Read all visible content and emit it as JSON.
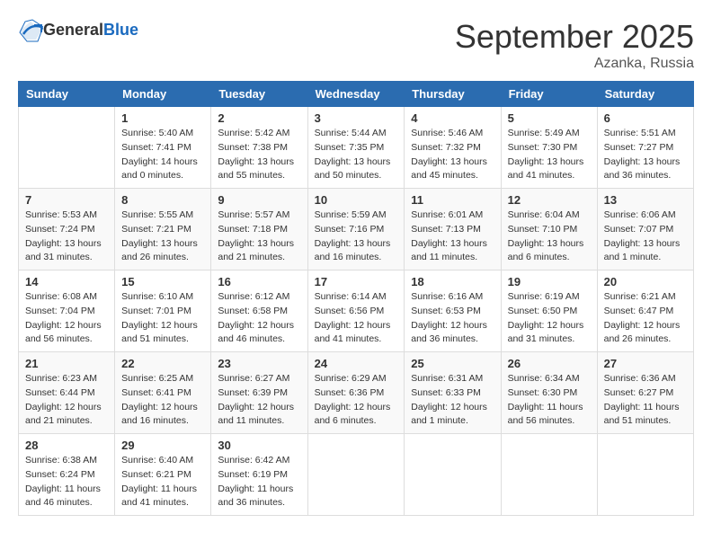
{
  "header": {
    "logo_general": "General",
    "logo_blue": "Blue",
    "month": "September 2025",
    "location": "Azanka, Russia"
  },
  "weekdays": [
    "Sunday",
    "Monday",
    "Tuesday",
    "Wednesday",
    "Thursday",
    "Friday",
    "Saturday"
  ],
  "weeks": [
    [
      {
        "day": "",
        "sunrise": "",
        "sunset": "",
        "daylight": ""
      },
      {
        "day": "1",
        "sunrise": "Sunrise: 5:40 AM",
        "sunset": "Sunset: 7:41 PM",
        "daylight": "Daylight: 14 hours and 0 minutes."
      },
      {
        "day": "2",
        "sunrise": "Sunrise: 5:42 AM",
        "sunset": "Sunset: 7:38 PM",
        "daylight": "Daylight: 13 hours and 55 minutes."
      },
      {
        "day": "3",
        "sunrise": "Sunrise: 5:44 AM",
        "sunset": "Sunset: 7:35 PM",
        "daylight": "Daylight: 13 hours and 50 minutes."
      },
      {
        "day": "4",
        "sunrise": "Sunrise: 5:46 AM",
        "sunset": "Sunset: 7:32 PM",
        "daylight": "Daylight: 13 hours and 45 minutes."
      },
      {
        "day": "5",
        "sunrise": "Sunrise: 5:49 AM",
        "sunset": "Sunset: 7:30 PM",
        "daylight": "Daylight: 13 hours and 41 minutes."
      },
      {
        "day": "6",
        "sunrise": "Sunrise: 5:51 AM",
        "sunset": "Sunset: 7:27 PM",
        "daylight": "Daylight: 13 hours and 36 minutes."
      }
    ],
    [
      {
        "day": "7",
        "sunrise": "Sunrise: 5:53 AM",
        "sunset": "Sunset: 7:24 PM",
        "daylight": "Daylight: 13 hours and 31 minutes."
      },
      {
        "day": "8",
        "sunrise": "Sunrise: 5:55 AM",
        "sunset": "Sunset: 7:21 PM",
        "daylight": "Daylight: 13 hours and 26 minutes."
      },
      {
        "day": "9",
        "sunrise": "Sunrise: 5:57 AM",
        "sunset": "Sunset: 7:18 PM",
        "daylight": "Daylight: 13 hours and 21 minutes."
      },
      {
        "day": "10",
        "sunrise": "Sunrise: 5:59 AM",
        "sunset": "Sunset: 7:16 PM",
        "daylight": "Daylight: 13 hours and 16 minutes."
      },
      {
        "day": "11",
        "sunrise": "Sunrise: 6:01 AM",
        "sunset": "Sunset: 7:13 PM",
        "daylight": "Daylight: 13 hours and 11 minutes."
      },
      {
        "day": "12",
        "sunrise": "Sunrise: 6:04 AM",
        "sunset": "Sunset: 7:10 PM",
        "daylight": "Daylight: 13 hours and 6 minutes."
      },
      {
        "day": "13",
        "sunrise": "Sunrise: 6:06 AM",
        "sunset": "Sunset: 7:07 PM",
        "daylight": "Daylight: 13 hours and 1 minute."
      }
    ],
    [
      {
        "day": "14",
        "sunrise": "Sunrise: 6:08 AM",
        "sunset": "Sunset: 7:04 PM",
        "daylight": "Daylight: 12 hours and 56 minutes."
      },
      {
        "day": "15",
        "sunrise": "Sunrise: 6:10 AM",
        "sunset": "Sunset: 7:01 PM",
        "daylight": "Daylight: 12 hours and 51 minutes."
      },
      {
        "day": "16",
        "sunrise": "Sunrise: 6:12 AM",
        "sunset": "Sunset: 6:58 PM",
        "daylight": "Daylight: 12 hours and 46 minutes."
      },
      {
        "day": "17",
        "sunrise": "Sunrise: 6:14 AM",
        "sunset": "Sunset: 6:56 PM",
        "daylight": "Daylight: 12 hours and 41 minutes."
      },
      {
        "day": "18",
        "sunrise": "Sunrise: 6:16 AM",
        "sunset": "Sunset: 6:53 PM",
        "daylight": "Daylight: 12 hours and 36 minutes."
      },
      {
        "day": "19",
        "sunrise": "Sunrise: 6:19 AM",
        "sunset": "Sunset: 6:50 PM",
        "daylight": "Daylight: 12 hours and 31 minutes."
      },
      {
        "day": "20",
        "sunrise": "Sunrise: 6:21 AM",
        "sunset": "Sunset: 6:47 PM",
        "daylight": "Daylight: 12 hours and 26 minutes."
      }
    ],
    [
      {
        "day": "21",
        "sunrise": "Sunrise: 6:23 AM",
        "sunset": "Sunset: 6:44 PM",
        "daylight": "Daylight: 12 hours and 21 minutes."
      },
      {
        "day": "22",
        "sunrise": "Sunrise: 6:25 AM",
        "sunset": "Sunset: 6:41 PM",
        "daylight": "Daylight: 12 hours and 16 minutes."
      },
      {
        "day": "23",
        "sunrise": "Sunrise: 6:27 AM",
        "sunset": "Sunset: 6:39 PM",
        "daylight": "Daylight: 12 hours and 11 minutes."
      },
      {
        "day": "24",
        "sunrise": "Sunrise: 6:29 AM",
        "sunset": "Sunset: 6:36 PM",
        "daylight": "Daylight: 12 hours and 6 minutes."
      },
      {
        "day": "25",
        "sunrise": "Sunrise: 6:31 AM",
        "sunset": "Sunset: 6:33 PM",
        "daylight": "Daylight: 12 hours and 1 minute."
      },
      {
        "day": "26",
        "sunrise": "Sunrise: 6:34 AM",
        "sunset": "Sunset: 6:30 PM",
        "daylight": "Daylight: 11 hours and 56 minutes."
      },
      {
        "day": "27",
        "sunrise": "Sunrise: 6:36 AM",
        "sunset": "Sunset: 6:27 PM",
        "daylight": "Daylight: 11 hours and 51 minutes."
      }
    ],
    [
      {
        "day": "28",
        "sunrise": "Sunrise: 6:38 AM",
        "sunset": "Sunset: 6:24 PM",
        "daylight": "Daylight: 11 hours and 46 minutes."
      },
      {
        "day": "29",
        "sunrise": "Sunrise: 6:40 AM",
        "sunset": "Sunset: 6:21 PM",
        "daylight": "Daylight: 11 hours and 41 minutes."
      },
      {
        "day": "30",
        "sunrise": "Sunrise: 6:42 AM",
        "sunset": "Sunset: 6:19 PM",
        "daylight": "Daylight: 11 hours and 36 minutes."
      },
      {
        "day": "",
        "sunrise": "",
        "sunset": "",
        "daylight": ""
      },
      {
        "day": "",
        "sunrise": "",
        "sunset": "",
        "daylight": ""
      },
      {
        "day": "",
        "sunrise": "",
        "sunset": "",
        "daylight": ""
      },
      {
        "day": "",
        "sunrise": "",
        "sunset": "",
        "daylight": ""
      }
    ]
  ]
}
